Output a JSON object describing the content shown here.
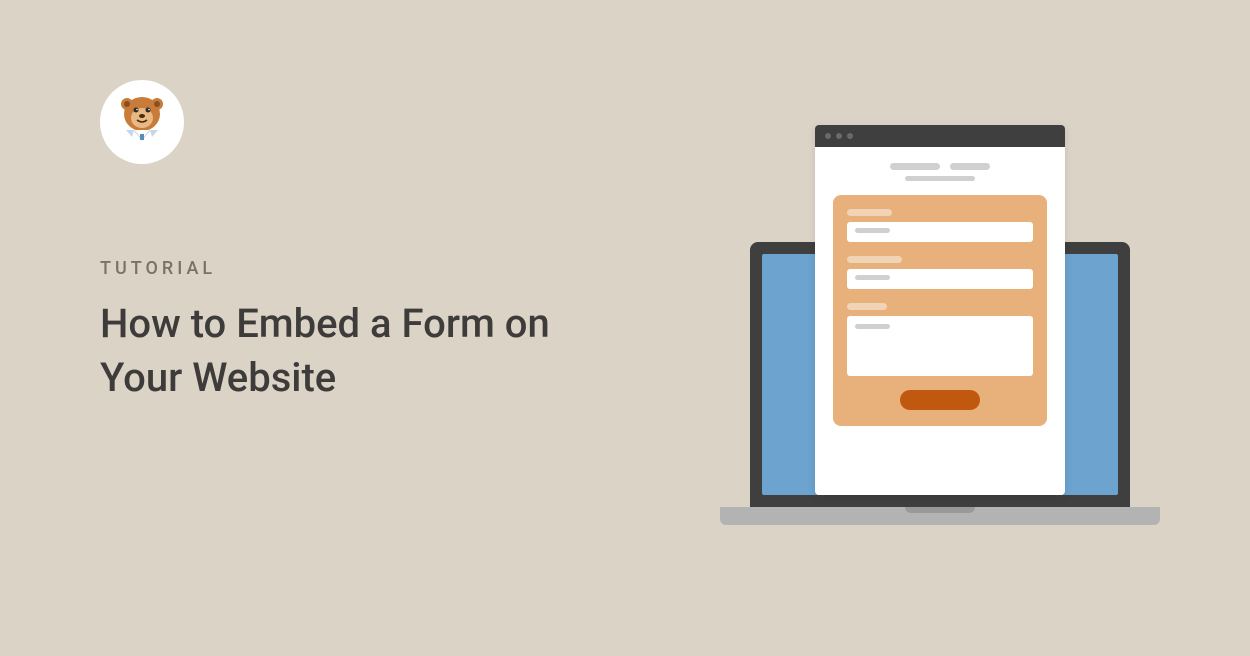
{
  "category": "TUTORIAL",
  "title": "How to Embed a Form on Your Website",
  "colors": {
    "background": "#dcd3c7",
    "titleText": "#3e3c3a",
    "categoryText": "#7a7268",
    "laptopScreen": "#6ca3cf",
    "formCard": "#e8b07a",
    "formButton": "#c1580f"
  },
  "logo": "bear-mascot"
}
